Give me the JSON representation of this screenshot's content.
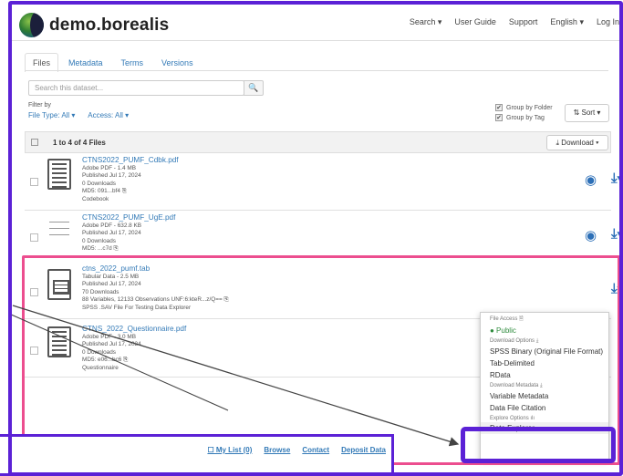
{
  "nav": {
    "brand": "demo.borealis",
    "links": [
      "Search ▾",
      "User Guide",
      "Support",
      "English ▾",
      "Log In"
    ]
  },
  "tabs": [
    "Files",
    "Metadata",
    "Terms",
    "Versions"
  ],
  "search": {
    "placeholder": "Search this dataset...",
    "button": "🔍"
  },
  "filters": {
    "label": "Filter by",
    "file_type": "File Type: All ▾",
    "access": "Access: All ▾"
  },
  "grouping": {
    "folder": "Group by Folder",
    "tag": "Group by Tag"
  },
  "sort_button": "⇅ Sort ▾",
  "table": {
    "count": "1 to 4 of 4 Files",
    "download_button": "⤓ Download ▾"
  },
  "files": [
    {
      "name": "CTNS2022_PUMF_Cdbk.pdf",
      "lines": [
        "Adobe PDF - 1.4 MB",
        "Published Jul 17, 2024",
        "0 Downloads",
        "MD5: 091...bf4 ⎘",
        "Codebook"
      ]
    },
    {
      "name": "CTNS2022_PUMF_UgE.pdf",
      "lines": [
        "Adobe PDF - 632.8 KB",
        "Published Jul 17, 2024",
        "0 Downloads",
        "MD5: ...c7d ⎘"
      ]
    },
    {
      "name": "ctns_2022_pumf.tab",
      "lines": [
        "Tabular Data - 2.5 MB",
        "Published Jul 17, 2024",
        "70 Downloads",
        "88 Variables, 12133 Observations UNF:6:kteR...z/Q== ⎘",
        "SPSS .SAV File For Testing Data Explorer"
      ]
    },
    {
      "name": "CTNS_2022_Questionnaire.pdf",
      "lines": [
        "Adobe PDF - 3.0 MB",
        "Published Jul 17, 2024",
        "0 Downloads",
        "MD5: e06...bc6 ⎘",
        "Questionnaire"
      ]
    }
  ],
  "dropdown": {
    "file_access_header": "File Access 🗎",
    "public": "● Public",
    "download_options_header": "Download Options ⤓",
    "download_items": [
      "SPSS Binary (Original File Format)",
      "Tab-Delimited",
      "RData"
    ],
    "download_metadata_header": "Download Metadata ⤓",
    "metadata_items": [
      "Variable Metadata",
      "Data File Citation"
    ],
    "explore_header": "Explore Options ılı",
    "explore_items": [
      "Data Explorer"
    ]
  },
  "footer": {
    "links": [
      "☐ My List (0)",
      "Browse",
      "Contact",
      "Deposit Data"
    ]
  },
  "colors": {
    "frame_purple": "#5b21d6",
    "highlight_pink": "#ec4e8f",
    "link_blue": "#337ab7",
    "icon_blue": "#2c6fb7",
    "public_green": "#2e8b3d"
  }
}
